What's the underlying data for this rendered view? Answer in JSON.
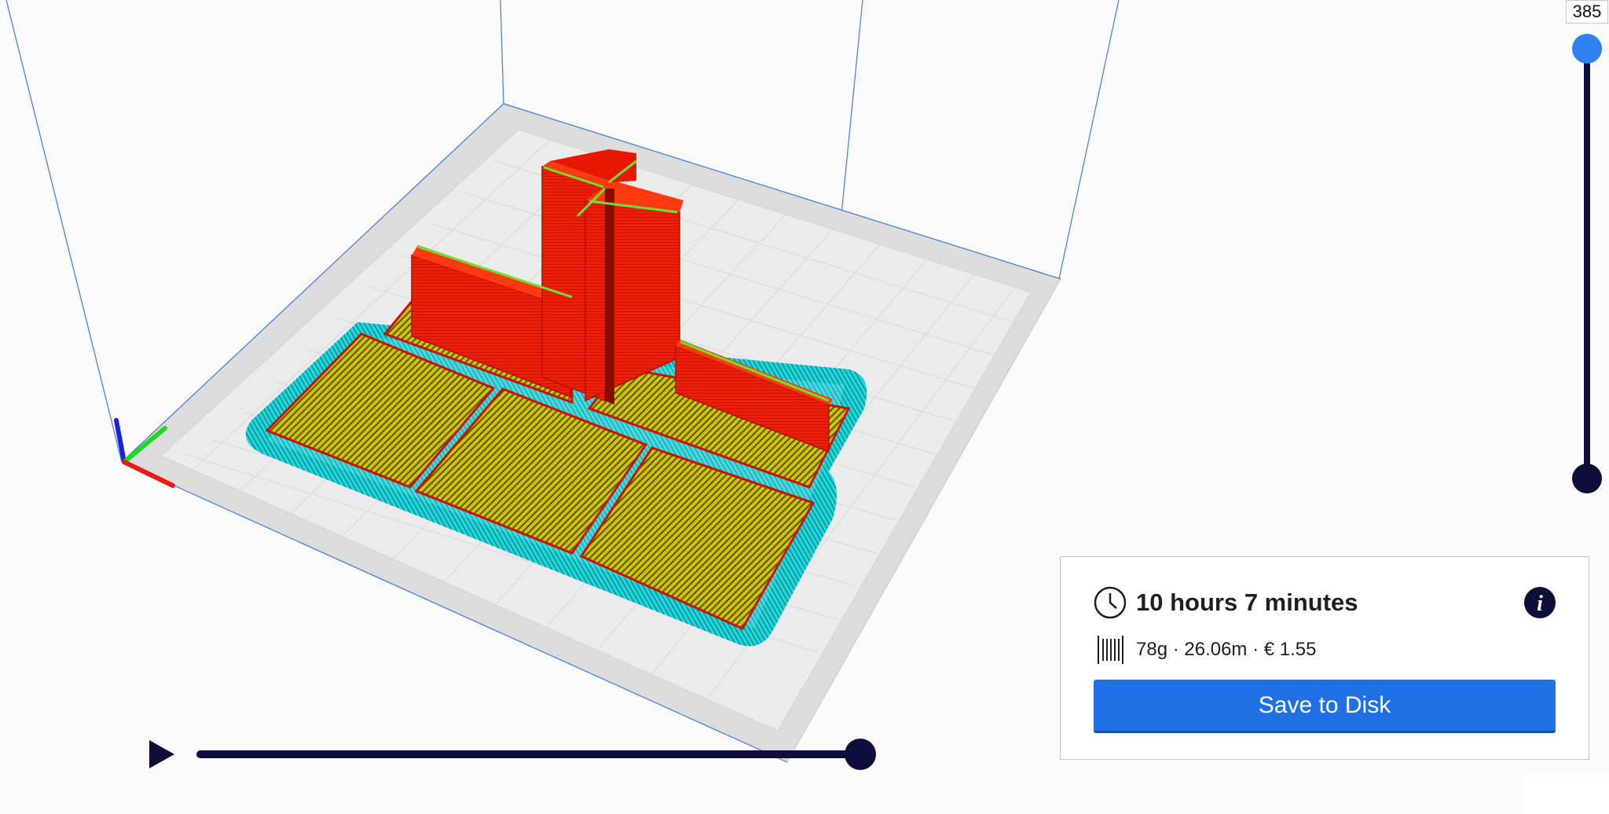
{
  "layer_slider": {
    "current_layer": "385"
  },
  "print_info": {
    "time": "10 hours 7 minutes",
    "material": "78g · 26.06m · € 1.55",
    "save_label": "Save to Disk"
  },
  "icons": {
    "clock": "clock-icon",
    "info": "info-icon",
    "filament": "filament-spool-icon",
    "play": "play-icon"
  },
  "colors": {
    "accent": "#1f6fe5",
    "dark": "#0d0e3a",
    "handle_active": "#2f80f0",
    "wall": "#f21a00",
    "infill": "#c9c000",
    "skirt": "#19d3d6"
  }
}
